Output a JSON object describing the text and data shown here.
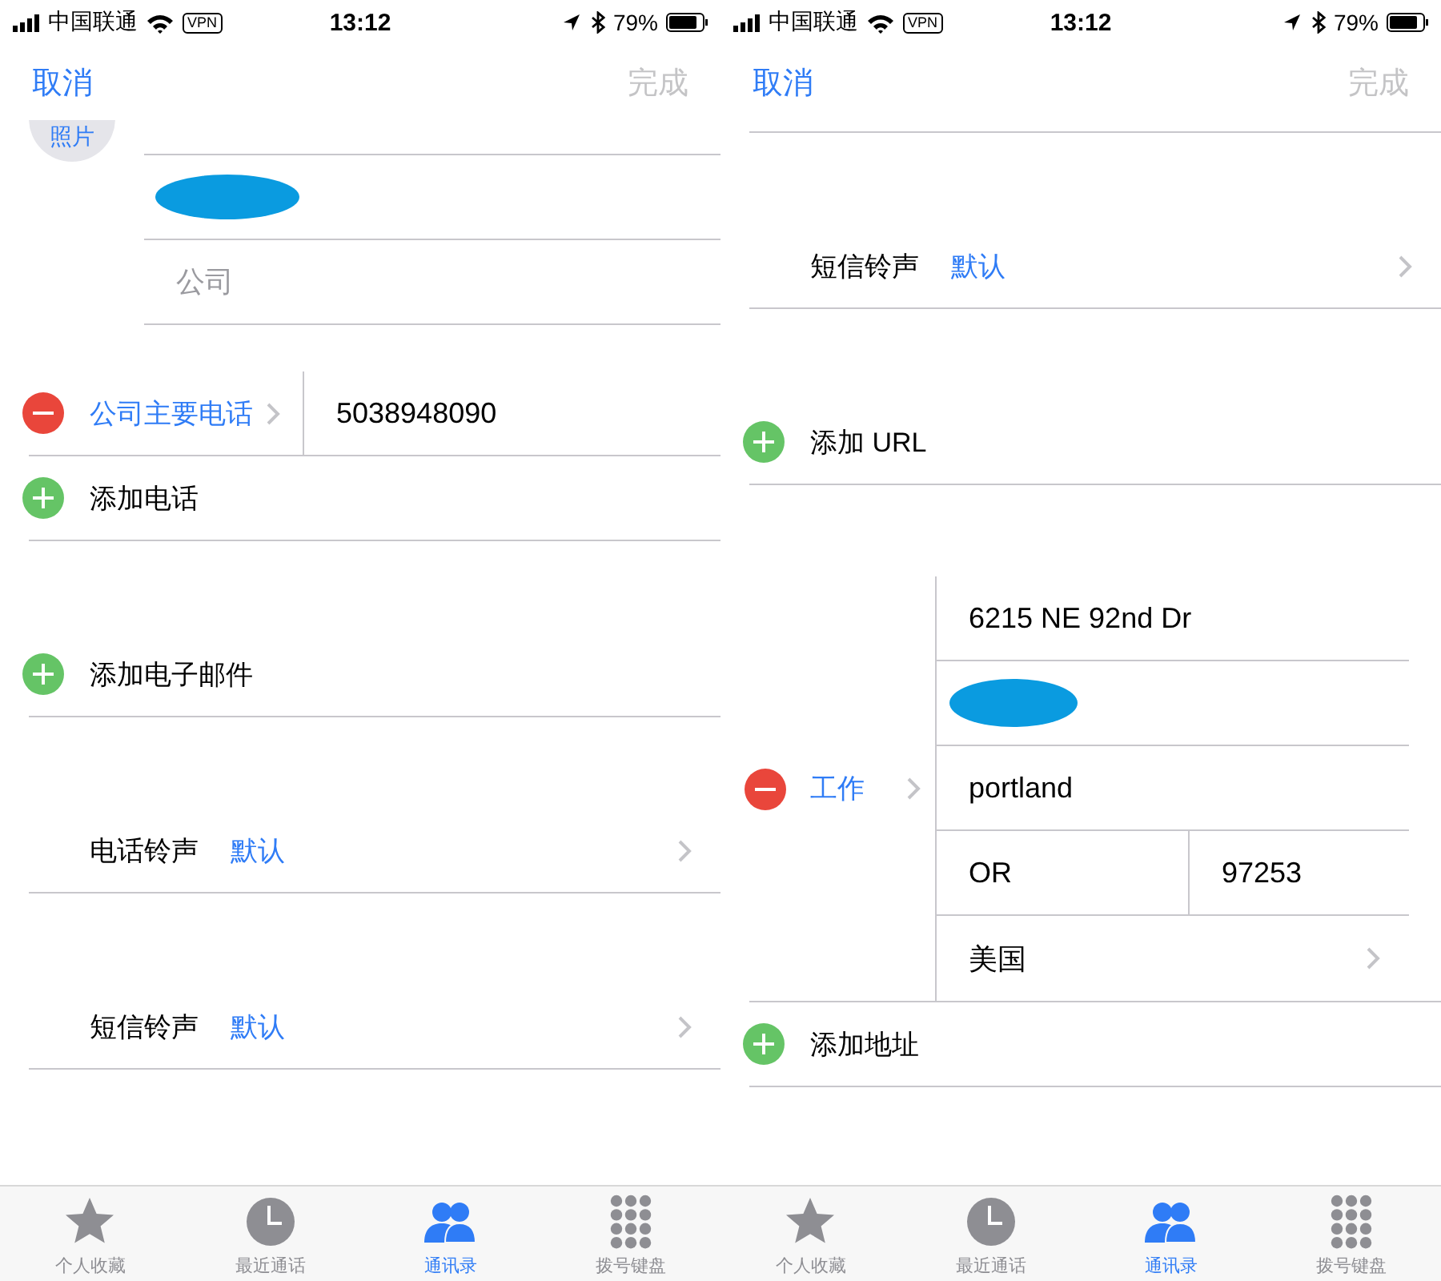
{
  "panels": [
    {
      "status_bar": {
        "carrier": "中国联通",
        "vpn": "VPN",
        "time": "13:12",
        "battery": "79%"
      },
      "nav": {
        "cancel": "取消",
        "done": "完成",
        "done_disabled": true
      },
      "groups": [
        {
          "kind": "name",
          "photo_label": "照片",
          "fields": [
            {
              "kind": "redacted"
            },
            {
              "kind": "placeholder",
              "text": "公司"
            }
          ]
        },
        {
          "kind": "rows",
          "rows": [
            {
              "kind": "phone",
              "label": "公司主要电话",
              "value": "5038948090"
            },
            {
              "kind": "add",
              "label": "添加电话"
            }
          ]
        },
        {
          "kind": "rows",
          "rows": [
            {
              "kind": "add",
              "label": "添加电子邮件"
            }
          ]
        },
        {
          "kind": "rows",
          "rows": [
            {
              "kind": "setting",
              "label": "电话铃声",
              "value": "默认"
            }
          ]
        },
        {
          "kind": "rows",
          "rows": [
            {
              "kind": "setting",
              "label": "短信铃声",
              "value": "默认"
            }
          ]
        }
      ],
      "tabs": [
        {
          "label": "个人收藏",
          "selected": false
        },
        {
          "label": "最近通话",
          "selected": false
        },
        {
          "label": "通讯录",
          "selected": true
        },
        {
          "label": "拨号键盘",
          "selected": false
        }
      ]
    },
    {
      "status_bar": {
        "carrier": "中国联通",
        "vpn": "VPN",
        "time": "13:12",
        "battery": "79%"
      },
      "nav": {
        "cancel": "取消",
        "done": "完成",
        "done_disabled": true
      },
      "groups": [
        {
          "kind": "rows",
          "rows": [
            {
              "kind": "setting",
              "label": "短信铃声",
              "value": "默认"
            }
          ]
        },
        {
          "kind": "rows",
          "rows": [
            {
              "kind": "add",
              "label": "添加 URL"
            }
          ]
        },
        {
          "kind": "rows",
          "rows": [
            {
              "kind": "address",
              "label": "工作",
              "lines": [
                {
                  "kind": "value",
                  "text": "6215 NE 92nd Dr"
                },
                {
                  "kind": "redacted"
                },
                {
                  "kind": "value",
                  "text": "portland"
                },
                {
                  "kind": "split",
                  "parts": [
                    "OR",
                    "97253"
                  ]
                },
                {
                  "kind": "select",
                  "text": "美国"
                }
              ]
            },
            {
              "kind": "add",
              "label": "添加地址"
            }
          ]
        }
      ],
      "tabs": [
        {
          "label": "个人收藏",
          "selected": false
        },
        {
          "label": "最近通话",
          "selected": false
        },
        {
          "label": "通讯录",
          "selected": true
        },
        {
          "label": "拨号键盘",
          "selected": false
        }
      ]
    }
  ]
}
